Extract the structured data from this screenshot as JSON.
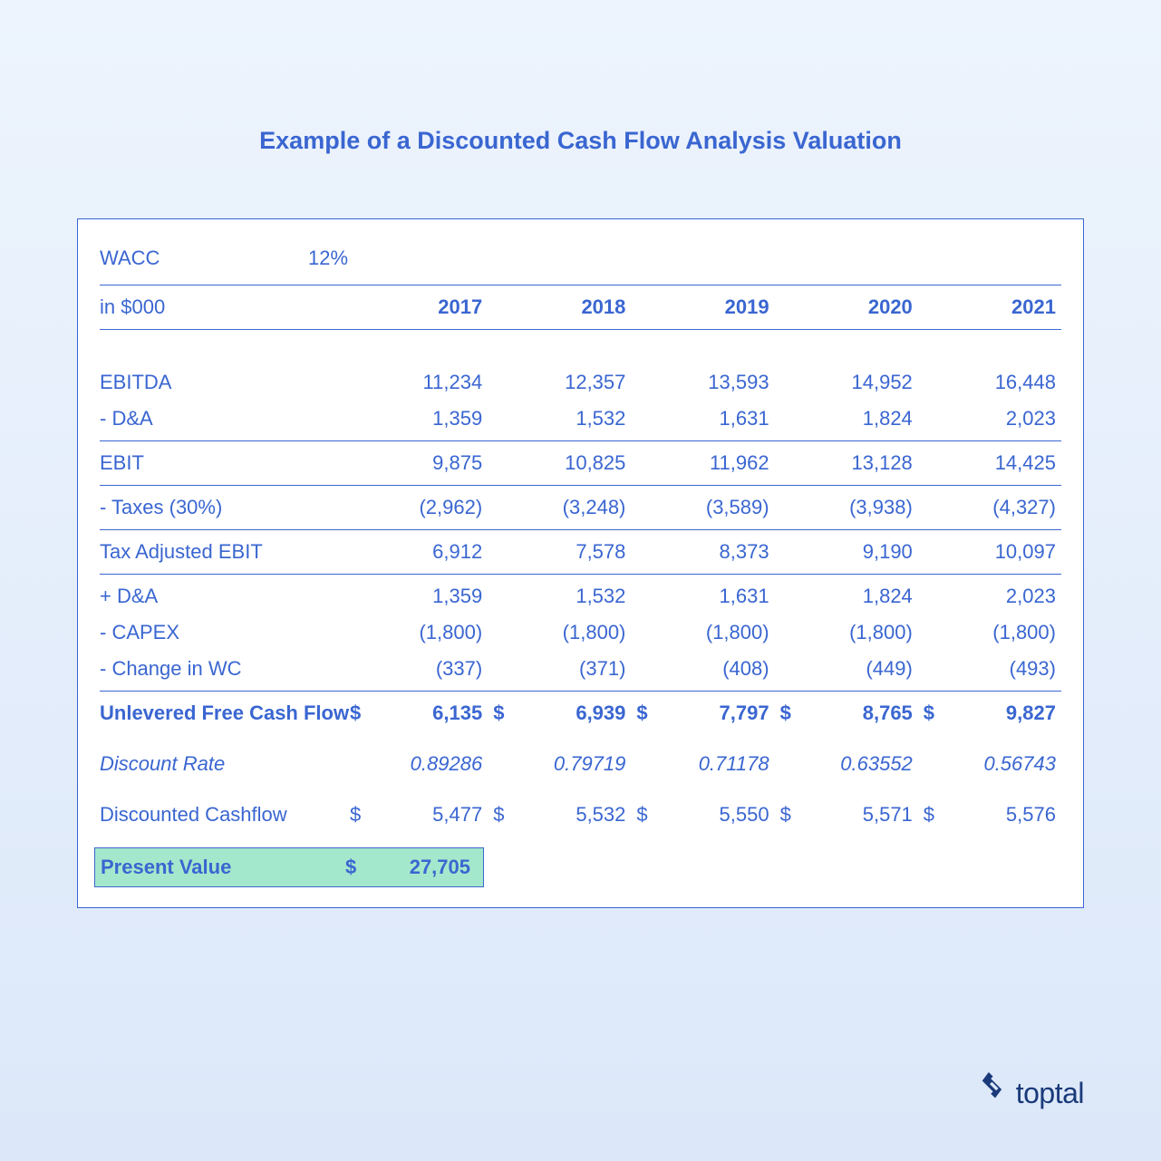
{
  "title": "Example of a Discounted Cash Flow Analysis Valuation",
  "wacc": {
    "label": "WACC",
    "value": "12%"
  },
  "header": {
    "label": "in $000",
    "years": [
      "2017",
      "2018",
      "2019",
      "2020",
      "2021"
    ]
  },
  "rows": {
    "ebitda": {
      "label": "EBITDA",
      "vals": [
        "11,234",
        "12,357",
        "13,593",
        "14,952",
        "16,448"
      ]
    },
    "da": {
      "label": "- D&A",
      "vals": [
        "1,359",
        "1,532",
        "1,631",
        "1,824",
        "2,023"
      ]
    },
    "ebit": {
      "label": "EBIT",
      "vals": [
        "9,875",
        "10,825",
        "11,962",
        "13,128",
        "14,425"
      ]
    },
    "taxes": {
      "label": "- Taxes (30%)",
      "vals": [
        "(2,962)",
        "(3,248)",
        "(3,589)",
        "(3,938)",
        "(4,327)"
      ]
    },
    "taebit": {
      "label": "Tax Adjusted EBIT",
      "vals": [
        "6,912",
        "7,578",
        "8,373",
        "9,190",
        "10,097"
      ]
    },
    "plusda": {
      "label": "+ D&A",
      "vals": [
        "1,359",
        "1,532",
        "1,631",
        "1,824",
        "2,023"
      ]
    },
    "capex": {
      "label": "- CAPEX",
      "vals": [
        "(1,800)",
        "(1,800)",
        "(1,800)",
        "(1,800)",
        "(1,800)"
      ]
    },
    "dwc": {
      "label": "- Change in WC",
      "vals": [
        "(337)",
        "(371)",
        "(408)",
        "(449)",
        "(493)"
      ]
    },
    "ufcf": {
      "label": "Unlevered Free Cash Flow",
      "vals": [
        "6,135",
        "6,939",
        "7,797",
        "8,765",
        "9,827"
      ],
      "currency": "$"
    },
    "drate": {
      "label": "Discount Rate",
      "vals": [
        "0.89286",
        "0.79719",
        "0.71178",
        "0.63552",
        "0.56743"
      ]
    },
    "dcf": {
      "label": "Discounted Cashflow",
      "vals": [
        "5,477",
        "5,532",
        "5,550",
        "5,571",
        "5,576"
      ],
      "currency": "$"
    }
  },
  "pv": {
    "label": "Present Value",
    "currency": "$",
    "value": "27,705"
  },
  "brand": "toptal",
  "chart_data": {
    "type": "table",
    "title": "Example of a Discounted Cash Flow Analysis Valuation",
    "wacc_percent": 12,
    "tax_rate_percent": 30,
    "units": "$000",
    "years": [
      2017,
      2018,
      2019,
      2020,
      2021
    ],
    "series": [
      {
        "name": "EBITDA",
        "values": [
          11234,
          12357,
          13593,
          14952,
          16448
        ]
      },
      {
        "name": "D&A",
        "values": [
          1359,
          1532,
          1631,
          1824,
          2023
        ]
      },
      {
        "name": "EBIT",
        "values": [
          9875,
          10825,
          11962,
          13128,
          14425
        ]
      },
      {
        "name": "Taxes (30%)",
        "values": [
          -2962,
          -3248,
          -3589,
          -3938,
          -4327
        ]
      },
      {
        "name": "Tax Adjusted EBIT",
        "values": [
          6912,
          7578,
          8373,
          9190,
          10097
        ]
      },
      {
        "name": "+ D&A",
        "values": [
          1359,
          1532,
          1631,
          1824,
          2023
        ]
      },
      {
        "name": "CAPEX",
        "values": [
          -1800,
          -1800,
          -1800,
          -1800,
          -1800
        ]
      },
      {
        "name": "Change in WC",
        "values": [
          -337,
          -371,
          -408,
          -449,
          -493
        ]
      },
      {
        "name": "Unlevered Free Cash Flow",
        "values": [
          6135,
          6939,
          7797,
          8765,
          9827
        ]
      },
      {
        "name": "Discount Rate",
        "values": [
          0.89286,
          0.79719,
          0.71178,
          0.63552,
          0.56743
        ]
      },
      {
        "name": "Discounted Cashflow",
        "values": [
          5477,
          5532,
          5550,
          5571,
          5576
        ]
      }
    ],
    "present_value": 27705
  }
}
